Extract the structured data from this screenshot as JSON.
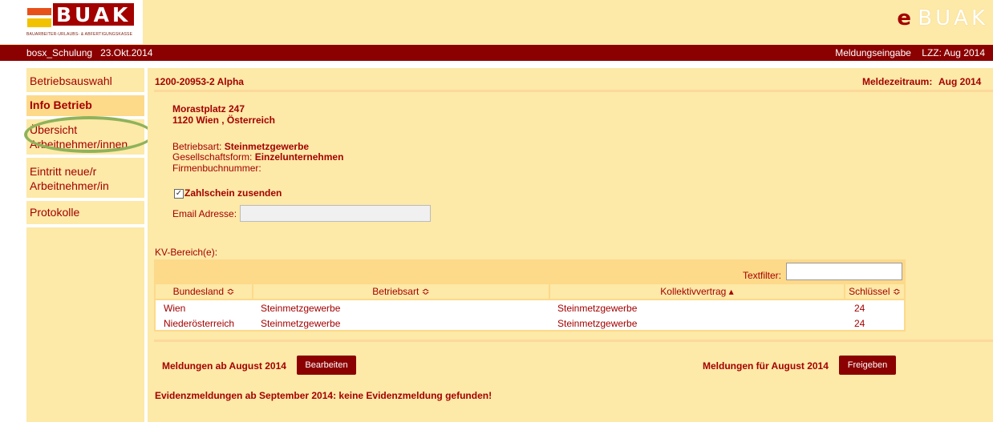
{
  "header": {
    "logo_text": "BUAK",
    "logo_sub": "BAUARBEITER-URLAUBS- & ABFERTIGUNGSKASSE",
    "ebuak_e": "e",
    "ebuak_rest": "BUAK"
  },
  "topbar": {
    "left": "bosx_Schulung   23.Okt.2014",
    "right": "Meldungseingabe    LZZ: Aug 2014"
  },
  "sidebar": {
    "items": [
      {
        "label": "Betriebsauswahl"
      },
      {
        "label": "Info Betrieb"
      },
      {
        "label": "Übersicht",
        "label2": "Arbeitnehmer/innen"
      },
      {
        "label": "Eintritt neue/r",
        "label2": "Arbeitnehmer/in"
      },
      {
        "label": "Protokolle"
      }
    ]
  },
  "company": {
    "id_name": "1200-20953-2   Alpha",
    "period_label": "Meldezeitraum:",
    "period_value": "Aug 2014",
    "street": "Morastplatz 247",
    "city": "1120 Wien , Österreich",
    "betriebsart_label": "Betriebsart:",
    "betriebsart_value": "Steinmetzgewerbe",
    "gesform_label": "Gesellschaftsform:",
    "gesform_value": "Einzelunternehmen",
    "firmenbuch_label": "Firmenbuchnummer:",
    "zahlschein_label": "Zahlschein zusenden",
    "zahlschein_checked": "✓",
    "email_label": "Email Adresse:",
    "email_value": ""
  },
  "kv": {
    "title": "KV-Bereich(e):",
    "textfilter_label": "Textfilter:",
    "textfilter_value": "",
    "columns": [
      "Bundesland ≎",
      "Betriebsart ≎",
      "Kollektivvertrag ▴",
      "Schlüssel ≎"
    ],
    "rows": [
      [
        "Wien",
        "Steinmetzgewerbe",
        "Steinmetzgewerbe",
        "24"
      ],
      [
        "Niederösterreich",
        "Steinmetzgewerbe",
        "Steinmetzgewerbe",
        "24"
      ]
    ]
  },
  "actions": {
    "meldungen_ab": "Meldungen ab August 2014",
    "bearbeiten": "Bearbeiten",
    "meldungen_fuer": "Meldungen für August 2014",
    "freigeben": "Freigeben",
    "evidenz": "Evidenzmeldungen ab September 2014: keine Evidenzmeldung gefunden!"
  },
  "colors": {
    "brand_red": "#8b0000",
    "panel": "#fde9a8",
    "highlight": "#8fb25a"
  }
}
